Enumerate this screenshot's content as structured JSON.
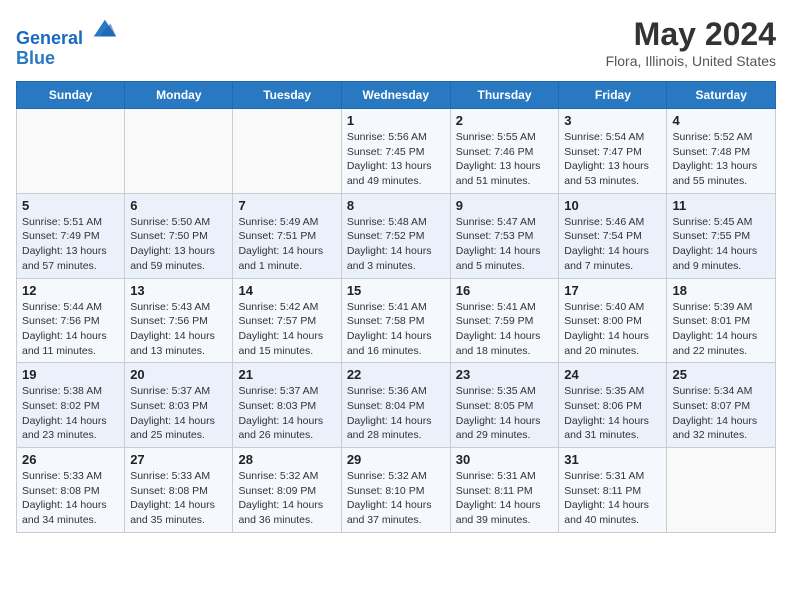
{
  "header": {
    "logo_line1": "General",
    "logo_line2": "Blue",
    "title": "May 2024",
    "subtitle": "Flora, Illinois, United States"
  },
  "weekdays": [
    "Sunday",
    "Monday",
    "Tuesday",
    "Wednesday",
    "Thursday",
    "Friday",
    "Saturday"
  ],
  "weeks": [
    [
      {
        "day": "",
        "info": ""
      },
      {
        "day": "",
        "info": ""
      },
      {
        "day": "",
        "info": ""
      },
      {
        "day": "1",
        "info": "Sunrise: 5:56 AM\nSunset: 7:45 PM\nDaylight: 13 hours\nand 49 minutes."
      },
      {
        "day": "2",
        "info": "Sunrise: 5:55 AM\nSunset: 7:46 PM\nDaylight: 13 hours\nand 51 minutes."
      },
      {
        "day": "3",
        "info": "Sunrise: 5:54 AM\nSunset: 7:47 PM\nDaylight: 13 hours\nand 53 minutes."
      },
      {
        "day": "4",
        "info": "Sunrise: 5:52 AM\nSunset: 7:48 PM\nDaylight: 13 hours\nand 55 minutes."
      }
    ],
    [
      {
        "day": "5",
        "info": "Sunrise: 5:51 AM\nSunset: 7:49 PM\nDaylight: 13 hours\nand 57 minutes."
      },
      {
        "day": "6",
        "info": "Sunrise: 5:50 AM\nSunset: 7:50 PM\nDaylight: 13 hours\nand 59 minutes."
      },
      {
        "day": "7",
        "info": "Sunrise: 5:49 AM\nSunset: 7:51 PM\nDaylight: 14 hours\nand 1 minute."
      },
      {
        "day": "8",
        "info": "Sunrise: 5:48 AM\nSunset: 7:52 PM\nDaylight: 14 hours\nand 3 minutes."
      },
      {
        "day": "9",
        "info": "Sunrise: 5:47 AM\nSunset: 7:53 PM\nDaylight: 14 hours\nand 5 minutes."
      },
      {
        "day": "10",
        "info": "Sunrise: 5:46 AM\nSunset: 7:54 PM\nDaylight: 14 hours\nand 7 minutes."
      },
      {
        "day": "11",
        "info": "Sunrise: 5:45 AM\nSunset: 7:55 PM\nDaylight: 14 hours\nand 9 minutes."
      }
    ],
    [
      {
        "day": "12",
        "info": "Sunrise: 5:44 AM\nSunset: 7:56 PM\nDaylight: 14 hours\nand 11 minutes."
      },
      {
        "day": "13",
        "info": "Sunrise: 5:43 AM\nSunset: 7:56 PM\nDaylight: 14 hours\nand 13 minutes."
      },
      {
        "day": "14",
        "info": "Sunrise: 5:42 AM\nSunset: 7:57 PM\nDaylight: 14 hours\nand 15 minutes."
      },
      {
        "day": "15",
        "info": "Sunrise: 5:41 AM\nSunset: 7:58 PM\nDaylight: 14 hours\nand 16 minutes."
      },
      {
        "day": "16",
        "info": "Sunrise: 5:41 AM\nSunset: 7:59 PM\nDaylight: 14 hours\nand 18 minutes."
      },
      {
        "day": "17",
        "info": "Sunrise: 5:40 AM\nSunset: 8:00 PM\nDaylight: 14 hours\nand 20 minutes."
      },
      {
        "day": "18",
        "info": "Sunrise: 5:39 AM\nSunset: 8:01 PM\nDaylight: 14 hours\nand 22 minutes."
      }
    ],
    [
      {
        "day": "19",
        "info": "Sunrise: 5:38 AM\nSunset: 8:02 PM\nDaylight: 14 hours\nand 23 minutes."
      },
      {
        "day": "20",
        "info": "Sunrise: 5:37 AM\nSunset: 8:03 PM\nDaylight: 14 hours\nand 25 minutes."
      },
      {
        "day": "21",
        "info": "Sunrise: 5:37 AM\nSunset: 8:03 PM\nDaylight: 14 hours\nand 26 minutes."
      },
      {
        "day": "22",
        "info": "Sunrise: 5:36 AM\nSunset: 8:04 PM\nDaylight: 14 hours\nand 28 minutes."
      },
      {
        "day": "23",
        "info": "Sunrise: 5:35 AM\nSunset: 8:05 PM\nDaylight: 14 hours\nand 29 minutes."
      },
      {
        "day": "24",
        "info": "Sunrise: 5:35 AM\nSunset: 8:06 PM\nDaylight: 14 hours\nand 31 minutes."
      },
      {
        "day": "25",
        "info": "Sunrise: 5:34 AM\nSunset: 8:07 PM\nDaylight: 14 hours\nand 32 minutes."
      }
    ],
    [
      {
        "day": "26",
        "info": "Sunrise: 5:33 AM\nSunset: 8:08 PM\nDaylight: 14 hours\nand 34 minutes."
      },
      {
        "day": "27",
        "info": "Sunrise: 5:33 AM\nSunset: 8:08 PM\nDaylight: 14 hours\nand 35 minutes."
      },
      {
        "day": "28",
        "info": "Sunrise: 5:32 AM\nSunset: 8:09 PM\nDaylight: 14 hours\nand 36 minutes."
      },
      {
        "day": "29",
        "info": "Sunrise: 5:32 AM\nSunset: 8:10 PM\nDaylight: 14 hours\nand 37 minutes."
      },
      {
        "day": "30",
        "info": "Sunrise: 5:31 AM\nSunset: 8:11 PM\nDaylight: 14 hours\nand 39 minutes."
      },
      {
        "day": "31",
        "info": "Sunrise: 5:31 AM\nSunset: 8:11 PM\nDaylight: 14 hours\nand 40 minutes."
      },
      {
        "day": "",
        "info": ""
      }
    ]
  ]
}
